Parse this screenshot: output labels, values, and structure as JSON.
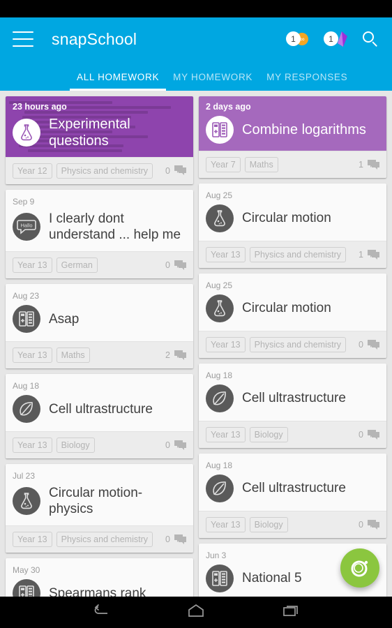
{
  "status_bar": {
    "label": ""
  },
  "appbar": {
    "menu_icon": "hamburger-menu-icon",
    "title": "snapSchool",
    "badges": [
      {
        "count": "1",
        "icon": "coin-icon",
        "glyph": "∞",
        "color": "#f5a623"
      },
      {
        "count": "1",
        "icon": "gem-icon",
        "glyph": "",
        "color": "#9b30d9"
      }
    ],
    "search_icon": "search-icon",
    "background": "#00a7e1"
  },
  "tabs": [
    {
      "label": "ALL HOMEWORK",
      "active": true
    },
    {
      "label": "MY HOMEWORK",
      "active": false
    },
    {
      "label": "MY RESPONSES",
      "active": false
    }
  ],
  "fab": {
    "icon": "camera-lens-icon",
    "color": "#8bc63f"
  },
  "navbar": [
    {
      "icon": "back-icon"
    },
    {
      "icon": "home-icon"
    },
    {
      "icon": "recents-icon"
    }
  ],
  "cards": {
    "left": [
      {
        "date": "23 hours ago",
        "title": "Experimental questions",
        "icon": "flask-icon",
        "year": "Year 12",
        "subject": "Physics and chemistry",
        "comments": "0",
        "featured": true,
        "has_image": true,
        "accent": "#8e44ad"
      },
      {
        "date": "Sep 9",
        "title": "I clearly dont understand ... help me",
        "icon": "speech-bubble-hallo-icon",
        "year": "Year 13",
        "subject": "German",
        "comments": "0",
        "featured": false
      },
      {
        "date": "Aug 23",
        "title": "Asap",
        "icon": "calculator-icon",
        "year": "Year 13",
        "subject": "Maths",
        "comments": "2",
        "featured": false
      },
      {
        "date": "Aug 18",
        "title": "Cell ultrastructure",
        "icon": "leaf-icon",
        "year": "Year 13",
        "subject": "Biology",
        "comments": "0",
        "featured": false
      },
      {
        "date": "Jul 23",
        "title": "Circular motion-physics",
        "icon": "flask-icon",
        "year": "Year 13",
        "subject": "Physics and chemistry",
        "comments": "0",
        "featured": false
      },
      {
        "date": "May 30",
        "title": "Spearmans rank",
        "icon": "calculator-icon",
        "year": "",
        "subject": "",
        "comments": "",
        "featured": false,
        "clipped": true
      }
    ],
    "right": [
      {
        "date": "2 days ago",
        "title": "Combine logarithms",
        "icon": "calculator-icon",
        "year": "Year 7",
        "subject": "Maths",
        "comments": "1",
        "featured": true,
        "has_image": false,
        "accent": "#a569bd"
      },
      {
        "date": "Aug 25",
        "title": "Circular motion",
        "icon": "flask-icon",
        "year": "Year 13",
        "subject": "Physics and chemistry",
        "comments": "1",
        "featured": false
      },
      {
        "date": "Aug 25",
        "title": "Circular motion",
        "icon": "flask-icon",
        "year": "Year 13",
        "subject": "Physics and chemistry",
        "comments": "0",
        "featured": false
      },
      {
        "date": "Aug 18",
        "title": "Cell ultrastructure",
        "icon": "leaf-icon",
        "year": "Year 13",
        "subject": "Biology",
        "comments": "0",
        "featured": false
      },
      {
        "date": "Aug 18",
        "title": "Cell ultrastructure",
        "icon": "leaf-icon",
        "year": "Year 13",
        "subject": "Biology",
        "comments": "0",
        "featured": false
      },
      {
        "date": "Jun 3",
        "title": "National 5",
        "icon": "calculator-icon",
        "year": "",
        "subject": "",
        "comments": "",
        "featured": false,
        "clipped": true
      }
    ]
  }
}
